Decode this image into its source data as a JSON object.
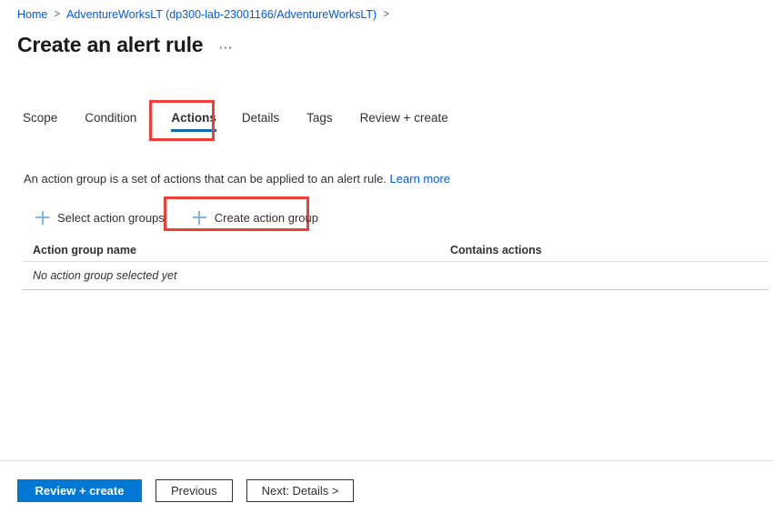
{
  "breadcrumb": {
    "items": [
      {
        "label": "Home",
        "separator": ">"
      },
      {
        "label": "AdventureWorksLT (dp300-lab-23001166/AdventureWorksLT)",
        "separator": ">"
      }
    ],
    "sep1": ">",
    "sep2": ">"
  },
  "header": {
    "title": "Create an alert rule",
    "ellipsis": "⋯"
  },
  "tabs": [
    {
      "label": "Scope",
      "selected": false
    },
    {
      "label": "Condition",
      "selected": false
    },
    {
      "label": "Actions",
      "selected": true
    },
    {
      "label": "Details",
      "selected": false
    },
    {
      "label": "Tags",
      "selected": false
    },
    {
      "label": "Review + create",
      "selected": false
    }
  ],
  "main": {
    "description": "An action group is a set of actions that can be applied to an alert rule.",
    "learn_more": "Learn more",
    "commands": {
      "select_action_groups": "Select action groups",
      "create_action_group": "Create action group",
      "plus_icon": "plus-icon"
    },
    "table": {
      "columns": [
        "Action group name",
        "Contains actions"
      ],
      "empty_message": "No action group selected yet"
    }
  },
  "footer": {
    "review_create": "Review + create",
    "previous": "Previous",
    "next": "Next: Details >"
  },
  "annotations": {
    "highlight_color": "#ef3e36",
    "targets": [
      "tab-actions",
      "create-action-group-button"
    ]
  },
  "colors": {
    "accent": "#0078d4",
    "link": "#015cda",
    "tab_underline": "#0f6cbd",
    "annotation_red": "#ef3e36"
  }
}
